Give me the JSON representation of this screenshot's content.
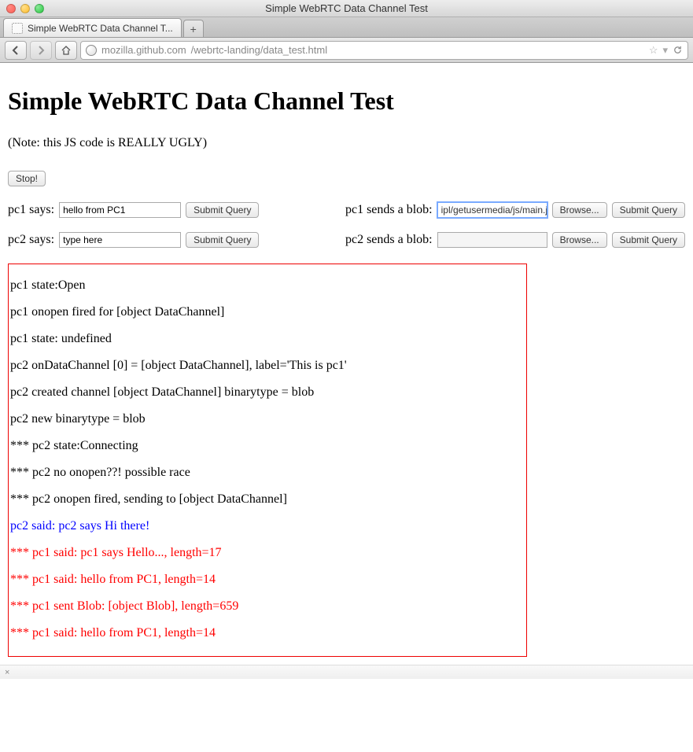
{
  "window": {
    "title": "Simple WebRTC Data Channel Test"
  },
  "tab": {
    "label": "Simple WebRTC Data Channel T..."
  },
  "url": {
    "host": "mozilla.github.com",
    "path": "/webrtc-landing/data_test.html"
  },
  "page": {
    "heading": "Simple WebRTC Data Channel Test",
    "note": "(Note: this JS code is REALLY UGLY)",
    "stop": "Stop!",
    "pc1_says_label": "pc1 says:",
    "pc1_says_value": "hello from PC1",
    "pc1_says_submit": "Submit Query",
    "pc1_blob_label": "pc1 sends a blob:",
    "pc1_blob_file": "ipl/getusermedia/js/main.js",
    "pc1_blob_browse": "Browse...",
    "pc1_blob_submit": "Submit Query",
    "pc2_says_label": "pc2 says:",
    "pc2_says_value": "type here",
    "pc2_says_submit": "Submit Query",
    "pc2_blob_label": "pc2 sends a blob:",
    "pc2_blob_file": "",
    "pc2_blob_browse": "Browse...",
    "pc2_blob_submit": "Submit Query"
  },
  "log": [
    {
      "text": "pc1 state:Open",
      "color": "black"
    },
    {
      "text": "pc1 onopen fired for [object DataChannel]",
      "color": "black"
    },
    {
      "text": "pc1 state: undefined",
      "color": "black"
    },
    {
      "text": "pc2 onDataChannel [0] = [object DataChannel], label='This is pc1'",
      "color": "black"
    },
    {
      "text": "pc2 created channel [object DataChannel] binarytype = blob",
      "color": "black"
    },
    {
      "text": "pc2 new binarytype = blob",
      "color": "black"
    },
    {
      "text": "*** pc2 state:Connecting",
      "color": "black"
    },
    {
      "text": "*** pc2 no onopen??! possible race",
      "color": "black"
    },
    {
      "text": "*** pc2 onopen fired, sending to [object DataChannel]",
      "color": "black"
    },
    {
      "text": "pc2 said: pc2 says Hi there!",
      "color": "blue"
    },
    {
      "text": "*** pc1 said: pc1 says Hello..., length=17",
      "color": "red"
    },
    {
      "text": "*** pc1 said: hello from PC1, length=14",
      "color": "red"
    },
    {
      "text": "*** pc1 sent Blob: [object Blob], length=659",
      "color": "red"
    },
    {
      "text": "*** pc1 said: hello from PC1, length=14",
      "color": "red"
    }
  ],
  "statusbar": {
    "text": "×"
  }
}
